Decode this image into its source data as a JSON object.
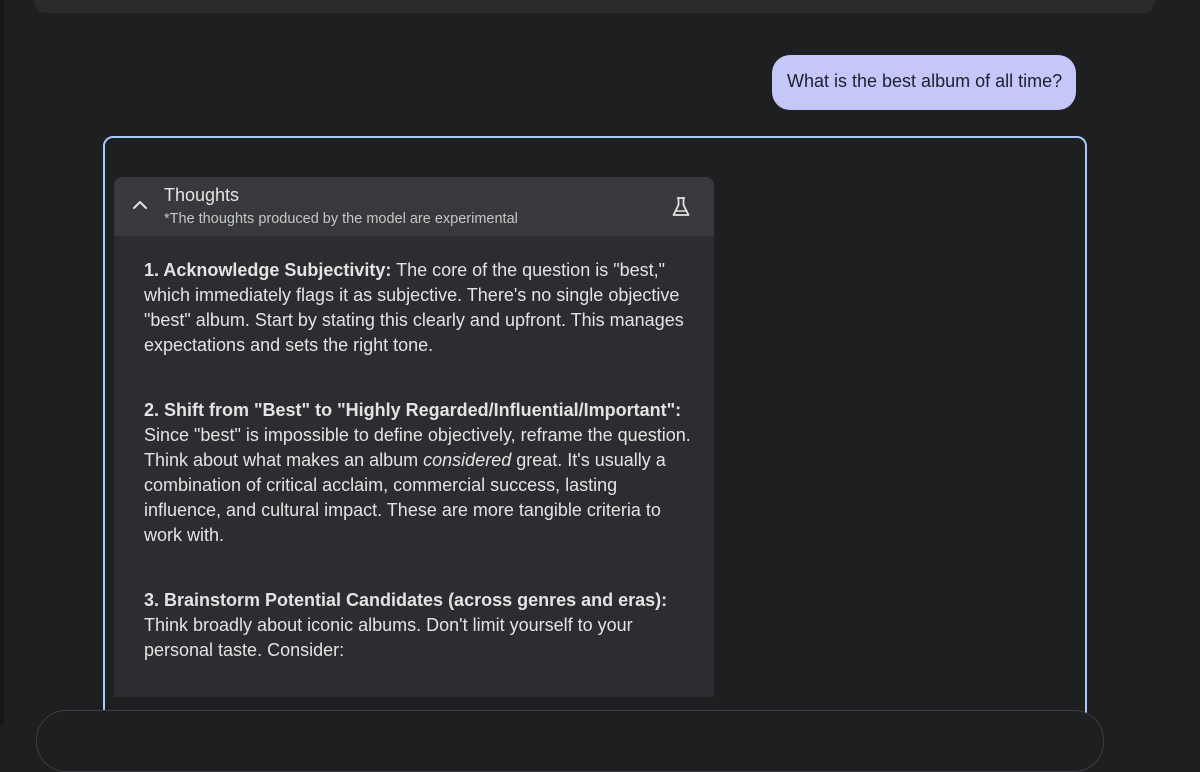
{
  "user_message": "What is the best album of all time?",
  "thoughts": {
    "title": "Thoughts",
    "subtitle": "*The thoughts produced by the model are experimental",
    "icons": {
      "collapse": "chevron-up-icon",
      "experimental": "flask-icon"
    },
    "steps": [
      {
        "title": "1. Acknowledge Subjectivity:",
        "text": " The core of the question is \"best,\" which immediately flags it as subjective. There's no single objective \"best\" album. Start by stating this clearly and upfront. This manages expectations and sets the right tone."
      },
      {
        "title": "2. Shift from \"Best\" to \"Highly Regarded/Influential/Important\":",
        "text_before": " Since \"best\" is impossible to define objectively, reframe the question. Think about what makes an album ",
        "emphasis": "considered",
        "text_after": " great. It's usually a combination of critical acclaim, commercial success, lasting influence, and cultural impact. These are more tangible criteria to work with."
      },
      {
        "title": "3. Brainstorm Potential Candidates (across genres and eras):",
        "text": " Think broadly about iconic albums. Don't limit yourself to your personal taste. Consider:"
      }
    ]
  },
  "colors": {
    "background": "#1e1f20",
    "user_bubble": "#c4c7f7",
    "response_border": "#a8c7fa",
    "thoughts_panel": "#2c2d30",
    "thoughts_header": "#38393c"
  }
}
